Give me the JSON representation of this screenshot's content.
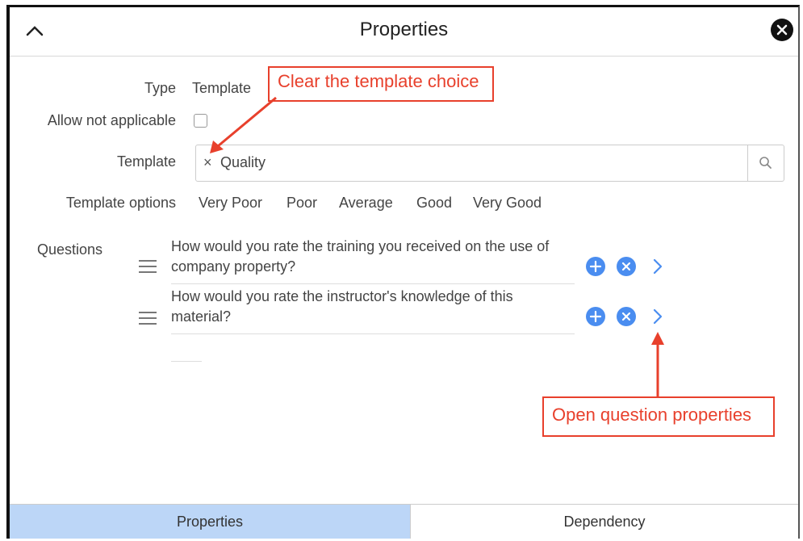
{
  "header": {
    "title": "Properties"
  },
  "fields": {
    "type_label": "Type",
    "type_value": "Template",
    "allow_na_label": "Allow not applicable",
    "template_label": "Template",
    "template_value": "Quality",
    "template_remove": "×",
    "template_options_label": "Template options",
    "template_options": [
      "Very Poor",
      "Poor",
      "Average",
      "Good",
      "Very Good"
    ],
    "questions_label": "Questions"
  },
  "questions": [
    {
      "text": "How would you rate the training you received on the use of company property?"
    },
    {
      "text": "How would you rate the instructor's knowledge of this material?"
    }
  ],
  "callouts": {
    "clear_template": "Clear the template choice",
    "open_question": "Open question properties"
  },
  "tabs": [
    {
      "label": "Properties",
      "active": true
    },
    {
      "label": "Dependency",
      "active": false
    }
  ],
  "colors": {
    "accent": "#4a8df0",
    "callout": "#e8402c",
    "active_tab": "#bcd6f7"
  },
  "icons": [
    "chevron-up-icon",
    "close-icon",
    "search-icon",
    "drag-handle-icon",
    "plus-circle-icon",
    "x-circle-icon",
    "chevron-right-icon"
  ]
}
